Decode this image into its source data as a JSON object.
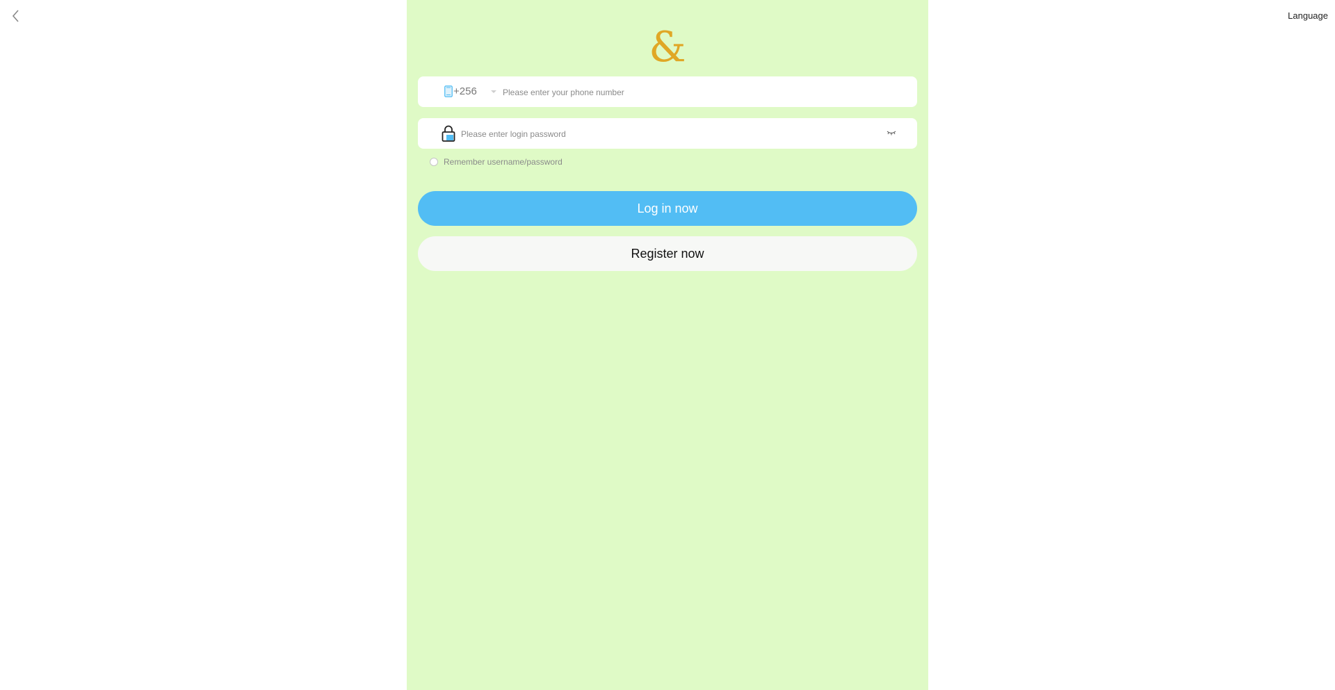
{
  "header": {
    "language_label": "Language"
  },
  "logo": {
    "symbol": "&"
  },
  "phone": {
    "country_code": "+256",
    "placeholder": "Please enter your phone number",
    "value": ""
  },
  "password": {
    "placeholder": "Please enter login password",
    "value": ""
  },
  "remember": {
    "label": "Remember username/password",
    "checked": false
  },
  "buttons": {
    "login_label": "Log in now",
    "register_label": "Register now"
  },
  "colors": {
    "panel_bg": "#dffac6",
    "primary": "#52bdf4",
    "logo": "#e0a726"
  },
  "icons": {
    "back": "chevron-left-icon",
    "phone": "phone-icon",
    "lock": "lock-icon",
    "eye": "eye-closed-icon",
    "caret": "caret-down-icon"
  }
}
